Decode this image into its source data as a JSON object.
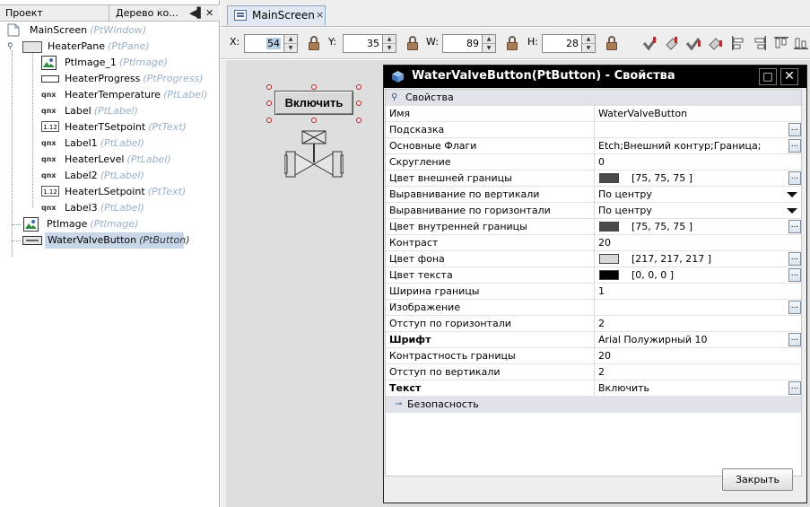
{
  "left_panel": {
    "tabs": [
      {
        "label": "Проект"
      },
      {
        "label": "Дерево ко..."
      }
    ],
    "tree": [
      {
        "name": "MainScreen",
        "type": "(PtWindow)",
        "icon": "window-icon"
      },
      {
        "name": "HeaterPane",
        "type": "(PtPane)",
        "icon": "pane-icon"
      },
      {
        "name": "PtImage_1",
        "type": "(PtImage)",
        "icon": "image-icon"
      },
      {
        "name": "HeaterProgress",
        "type": "(PtProgress)",
        "icon": "progress-icon"
      },
      {
        "name": "HeaterTemperature",
        "type": "(PtLabel)",
        "icon": "label-icon"
      },
      {
        "name": "Label",
        "type": "(PtLabel)",
        "icon": "label-icon"
      },
      {
        "name": "HeaterTSetpoint",
        "type": "(PtText)",
        "icon": "text-field-icon"
      },
      {
        "name": "Label1",
        "type": "(PtLabel)",
        "icon": "label-icon"
      },
      {
        "name": "HeaterLevel",
        "type": "(PtLabel)",
        "icon": "label-icon"
      },
      {
        "name": "Label2",
        "type": "(PtLabel)",
        "icon": "label-icon"
      },
      {
        "name": "HeaterLSetpoint",
        "type": "(PtText)",
        "icon": "text-field-icon"
      },
      {
        "name": "Label3",
        "type": "(PtLabel)",
        "icon": "label-icon"
      },
      {
        "name": "PtImage",
        "type": "(PtImage)",
        "icon": "image-icon"
      },
      {
        "name": "WaterValveButton",
        "type": "(PtButton)",
        "icon": "button-icon"
      }
    ],
    "icon_labels": {
      "label": "qnx",
      "text": "1.12"
    }
  },
  "editor": {
    "tab_label": "MainScreen",
    "tab_close": "×"
  },
  "toolbar": {
    "x_label": "X:",
    "x_value": "54",
    "y_label": "Y:",
    "y_value": "35",
    "w_label": "W:",
    "w_value": "89",
    "h_label": "H:",
    "h_value": "28",
    "spin_up": "▲",
    "spin_down": "▼"
  },
  "canvas": {
    "button_text": "Включить"
  },
  "dialog": {
    "title": "WaterValveButton(PtButton) - Свойства",
    "max_glyph": "□",
    "close_glyph": "✕",
    "group_properties": "Свойства",
    "group_security": "Безопасность",
    "ellipsis_glyph": "...",
    "rows": [
      {
        "name": "Имя",
        "value": "WaterValveButton"
      },
      {
        "name": "Подсказка",
        "value": "",
        "ellipsis": true
      },
      {
        "name": "Основные Флаги",
        "value": "Etch;Внешний контур;Граница;",
        "ellipsis": true
      },
      {
        "name": "Скругление",
        "value": "0"
      },
      {
        "name": "Цвет внешней границы",
        "value": "[75, 75, 75 ]",
        "swatch": "#4b4b4b",
        "ellipsis": true
      },
      {
        "name": "Выравнивание по вертикали",
        "value": "По центру",
        "dropdown": true
      },
      {
        "name": "Выравнивание по горизонтали",
        "value": "По центру",
        "dropdown": true
      },
      {
        "name": "Цвет внутренней границы",
        "value": "[75, 75, 75 ]",
        "swatch": "#4b4b4b",
        "ellipsis": true
      },
      {
        "name": "Контраст",
        "value": "20"
      },
      {
        "name": "Цвет фона",
        "value": "[217, 217, 217 ]",
        "swatch": "#d9d9d9",
        "ellipsis": true
      },
      {
        "name": "Цвет текста",
        "value": "[0, 0, 0 ]",
        "swatch": "#000000",
        "ellipsis": true
      },
      {
        "name": "Ширина границы",
        "value": "1"
      },
      {
        "name": "Изображение",
        "value": "",
        "ellipsis": true
      },
      {
        "name": "Отступ по горизонтали",
        "value": "2"
      },
      {
        "name": "Шрифт",
        "value": "Arial Полужирный 10",
        "bold": true,
        "ellipsis": true
      },
      {
        "name": "Контрастность границы",
        "value": "20"
      },
      {
        "name": "Отступ по вертикали",
        "value": "2"
      },
      {
        "name": "Текст",
        "value": "Включить",
        "bold": true,
        "ellipsis": true
      }
    ],
    "close_button": "Закрыть"
  }
}
